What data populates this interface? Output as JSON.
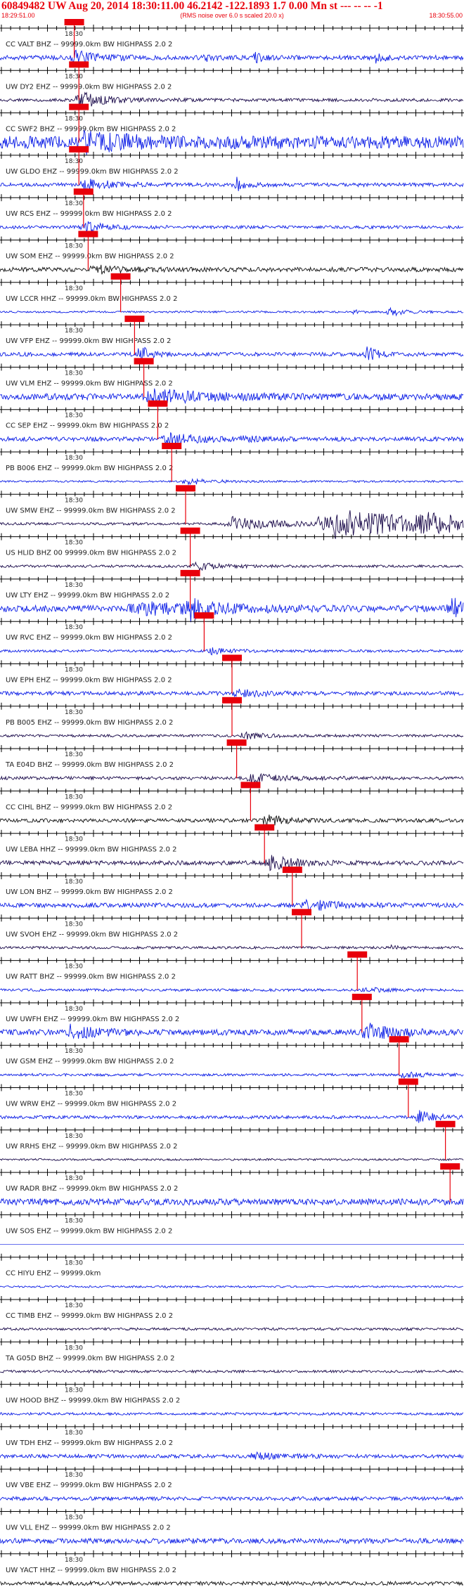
{
  "header": {
    "title": "60849482 UW Aug 20, 2014 18:30:11.00   46.2142 -122.1893  1.7 0.00 Mn st --- -- --  -1",
    "start_time": "18:29:51.00",
    "end_time": "18:30:55.00",
    "scale_note": "(RMS noise over 6.0 s scaled 20.0 x)"
  },
  "colors": {
    "blue": "#0b1de6",
    "dark": "#1a0a4a",
    "black": "#111111",
    "pick": "#e8000b",
    "axis": "#000000"
  },
  "chart_data": {
    "type": "line",
    "title": "60849482 UW Aug 20, 2014 18:30:11.00   46.2142 -122.1893  1.7 0.00 Mn st --- -- --  -1",
    "x_range": [
      "18:29:51.00",
      "18:30:55.00"
    ],
    "tick_label": "18:30",
    "series": [
      {
        "name": "CC VALT BHZ -- 99999.0km BW  HIGHPASS  2.0  2",
        "color": "blue",
        "pick": 0.16,
        "amp": 0.35,
        "events": [
          [
            0.16,
            1.0,
            0.03
          ],
          [
            0.44,
            0.7,
            0.01
          ],
          [
            0.55,
            0.6,
            0.01
          ],
          [
            0.81,
            0.6,
            0.01
          ]
        ]
      },
      {
        "name": "UW DY2 EHZ -- 99999.0km BW  HIGHPASS  2.0  2",
        "color": "dark",
        "pick": 0.17,
        "amp": 0.25,
        "events": [
          [
            0.17,
            1.3,
            0.03
          ]
        ]
      },
      {
        "name": "CC SWF2 BHZ -- 99999.0km BW  HIGHPASS  2.0  2",
        "color": "blue",
        "pick": 0.17,
        "amp": 1.0,
        "events": [
          [
            0.18,
            1.2,
            0.05
          ]
        ]
      },
      {
        "name": "UW GLDO EHZ -- 99999.0km BW  HIGHPASS  2.0  2",
        "color": "blue",
        "pick": 0.17,
        "amp": 0.3,
        "events": [
          [
            0.18,
            1.0,
            0.03
          ],
          [
            0.51,
            1.0,
            0.01
          ]
        ]
      },
      {
        "name": "UW RCS EHZ -- 99999.0km BW  HIGHPASS  2.0  2",
        "color": "blue",
        "pick": 0.18,
        "amp": 0.25,
        "events": [
          [
            0.18,
            0.8,
            0.03
          ]
        ]
      },
      {
        "name": "UW SOM EHZ -- 99999.0km BW  HIGHPASS  2.0  2",
        "color": "black",
        "pick": 0.19,
        "amp": 0.35,
        "events": [
          [
            0.2,
            0.6,
            0.03
          ]
        ]
      },
      {
        "name": "UW LCCR HHZ -- 99999.0km BW  HIGHPASS  2.0  2",
        "color": "blue",
        "pick": 0.26,
        "amp": 0.15,
        "events": [
          [
            0.84,
            0.6,
            0.02
          ],
          [
            0.76,
            0.3,
            0.01
          ]
        ]
      },
      {
        "name": "UW VFP EHZ -- 99999.0km BW  HIGHPASS  2.0  2",
        "color": "blue",
        "pick": 0.29,
        "amp": 0.3,
        "events": [
          [
            0.3,
            1.6,
            0.01
          ],
          [
            0.79,
            1.6,
            0.01
          ]
        ]
      },
      {
        "name": "UW VLM EHZ -- 99999.0km BW  HIGHPASS  2.0  2",
        "color": "blue",
        "pick": 0.31,
        "amp": 0.5,
        "events": [
          [
            0.33,
            1.0,
            0.06
          ]
        ]
      },
      {
        "name": "CC SEP EHZ -- 99999.0km BW  HIGHPASS  2.0  2",
        "color": "blue",
        "pick": 0.34,
        "amp": 0.35,
        "events": [
          [
            0.36,
            0.8,
            0.04
          ],
          [
            0.52,
            0.6,
            0.01
          ]
        ]
      },
      {
        "name": "PB B006 EHZ -- 99999.0km BW  HIGHPASS  2.0  2",
        "color": "blue",
        "pick": 0.37,
        "amp": 0.15,
        "events": [
          [
            0.4,
            0.5,
            0.03
          ]
        ]
      },
      {
        "name": "UW SMW EHZ -- 99999.0km BW  HIGHPASS  2.0  2",
        "color": "dark",
        "pick": 0.4,
        "amp": 0.2,
        "events": [
          [
            0.5,
            1.0,
            0.06
          ],
          [
            0.72,
            2.2,
            0.12
          ],
          [
            0.9,
            1.0,
            0.06
          ]
        ]
      },
      {
        "name": "US HLID BHZ 00 99999.0km BW  HIGHPASS  2.0  2",
        "color": "dark",
        "pick": 0.41,
        "amp": 0.2,
        "events": [
          [
            0.42,
            0.6,
            0.03
          ]
        ]
      },
      {
        "name": "UW LTY EHZ -- 99999.0km BW  HIGHPASS  2.0  2",
        "color": "blue",
        "pick": 0.41,
        "amp": 0.5,
        "events": [
          [
            0.3,
            0.9,
            0.08
          ],
          [
            0.41,
            1.3,
            0.03
          ],
          [
            0.97,
            1.5,
            0.03
          ]
        ]
      },
      {
        "name": "UW RVC EHZ -- 99999.0km BW  HIGHPASS  2.0  2",
        "color": "blue",
        "pick": 0.44,
        "amp": 0.2,
        "events": [
          [
            0.45,
            0.6,
            0.02
          ]
        ]
      },
      {
        "name": "UW EPH EHZ -- 99999.0km BW  HIGHPASS  2.0  2",
        "color": "blue",
        "pick": 0.5,
        "amp": 0.3,
        "events": [
          [
            0.51,
            0.6,
            0.03
          ]
        ]
      },
      {
        "name": "PB B005 EHZ -- 99999.0km BW  HIGHPASS  2.0  2",
        "color": "dark",
        "pick": 0.5,
        "amp": 0.2,
        "events": [
          [
            0.52,
            0.5,
            0.03
          ]
        ]
      },
      {
        "name": "TA E04D BHZ -- 99999.0km BW  HIGHPASS  2.0  2",
        "color": "dark",
        "pick": 0.51,
        "amp": 0.25,
        "events": [
          [
            0.54,
            0.6,
            0.04
          ]
        ]
      },
      {
        "name": "CC CIHL BHZ -- 99999.0km BW  HIGHPASS  2.0  2",
        "color": "black",
        "pick": 0.54,
        "amp": 0.3,
        "events": [
          [
            0.57,
            1.3,
            0.02
          ]
        ]
      },
      {
        "name": "UW LEBA HHZ -- 99999.0km BW  HIGHPASS  2.0  2",
        "color": "dark",
        "pick": 0.57,
        "amp": 0.35,
        "events": [
          [
            0.58,
            1.0,
            0.03
          ]
        ]
      },
      {
        "name": "UW LON BHZ -- 99999.0km BW  HIGHPASS  2.0  2",
        "color": "blue",
        "pick": 0.63,
        "amp": 0.35,
        "events": [
          [
            0.66,
            0.8,
            0.04
          ]
        ]
      },
      {
        "name": "UW SVOH EHZ -- 99999.0km BW  HIGHPASS  2.0  2",
        "color": "dark",
        "pick": 0.65,
        "amp": 0.2,
        "events": [
          [
            0.84,
            0.4,
            0.01
          ]
        ]
      },
      {
        "name": "UW RATT BHZ -- 99999.0km BW  HIGHPASS  2.0  2",
        "color": "blue",
        "pick": 0.77,
        "amp": 0.2,
        "events": [
          [
            0.78,
            0.5,
            0.02
          ]
        ]
      },
      {
        "name": "UW UWFH EHZ -- 99999.0km BW  HIGHPASS  2.0  2",
        "color": "blue",
        "pick": 0.78,
        "amp": 0.45,
        "events": [
          [
            0.15,
            1.0,
            0.03
          ],
          [
            0.79,
            1.3,
            0.03
          ]
        ]
      },
      {
        "name": "UW GSM EHZ -- 99999.0km BW  HIGHPASS  2.0  2",
        "color": "blue",
        "pick": 0.86,
        "amp": 0.2,
        "events": [
          [
            0.87,
            0.6,
            0.02
          ]
        ]
      },
      {
        "name": "UW WRW EHZ -- 99999.0km BW  HIGHPASS  2.0  2",
        "color": "blue",
        "pick": 0.88,
        "amp": 0.25,
        "events": [
          [
            0.9,
            1.0,
            0.02
          ]
        ]
      },
      {
        "name": "UW RRHS EHZ -- 99999.0km BW  HIGHPASS  2.0  2",
        "color": "dark",
        "pick": 0.96,
        "amp": 0.15,
        "events": []
      },
      {
        "name": "UW RADR BHZ -- 99999.0km BW  HIGHPASS  2.0  2",
        "color": "blue",
        "pick": 0.97,
        "amp": 0.5,
        "events": []
      },
      {
        "name": "UW SOS EHZ -- 99999.0km BW  HIGHPASS  2.0  2",
        "color": "blue",
        "pick": null,
        "amp": 0.0,
        "events": []
      },
      {
        "name": "CC HIYU EHZ -- 99999.0km",
        "color": "blue",
        "pick": null,
        "amp": 0.15,
        "events": []
      },
      {
        "name": "CC TIMB EHZ -- 99999.0km BW  HIGHPASS  2.0  2",
        "color": "dark",
        "pick": null,
        "amp": 0.2,
        "events": []
      },
      {
        "name": "TA G05D BHZ -- 99999.0km BW  HIGHPASS  2.0  2",
        "color": "dark",
        "pick": null,
        "amp": 0.2,
        "events": []
      },
      {
        "name": "UW HOOD BHZ -- 99999.0km BW  HIGHPASS  2.0  2",
        "color": "blue",
        "pick": null,
        "amp": 0.2,
        "events": []
      },
      {
        "name": "UW TDH EHZ -- 99999.0km BW  HIGHPASS  2.0  2",
        "color": "blue",
        "pick": null,
        "amp": 0.3,
        "events": [
          [
            0.55,
            0.5,
            0.03
          ]
        ]
      },
      {
        "name": "UW VBE EHZ -- 99999.0km BW  HIGHPASS  2.0  2",
        "color": "blue",
        "pick": null,
        "amp": 0.3,
        "events": []
      },
      {
        "name": "UW VLL EHZ -- 99999.0km BW  HIGHPASS  2.0  2",
        "color": "blue",
        "pick": null,
        "amp": 0.4,
        "events": []
      },
      {
        "name": "UW YACT HHZ -- 99999.0km BW  HIGHPASS  2.0  2",
        "color": "black",
        "pick": null,
        "amp": 0.3,
        "events": []
      }
    ]
  }
}
